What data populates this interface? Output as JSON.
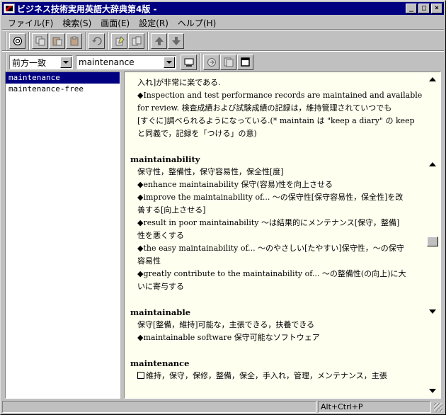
{
  "window": {
    "title": "ビジネス技術実用英語大辞典第4版 -"
  },
  "menu": [
    "ファイル(F)",
    "検索(S)",
    "画面(E)",
    "設定(R)",
    "ヘルプ(H)"
  ],
  "toolbar": {
    "icons": [
      "search-icon",
      "copy-icon",
      "paste-icon",
      "clipboard-icon",
      "undo-icon",
      "note-icon",
      "notes-icon",
      "up-arrow-icon",
      "down-arrow-icon"
    ]
  },
  "search": {
    "mode": "前方一致",
    "query": "maintenance"
  },
  "results": {
    "items": [
      "maintenance",
      "maintenance-free"
    ],
    "selected_index": 0
  },
  "content": {
    "lines_top": [
      "入れ]が非常に楽である.",
      "◆Inspection and test performance records are maintained and available",
      "for review.  検査成績および試験成績の記録は，維持管理されていつでも",
      "[すぐに]調べられるようになっている.(* maintain は \"keep a diary\" の keep",
      "と同義で，記録を「つける」の意)"
    ],
    "entries": [
      {
        "headword": "maintainability",
        "lines": [
          "保守性，整備性，保守容易性，保全性[度]",
          "◆enhance maintainability  保守(容易)性を向上させる",
          "◆improve the maintainability of...  ～の保守性[保守容易性，保全性]を改",
          "善する[向上させる]",
          "◆result in poor maintainability  ～は結果的にメンテナンス[保守，整備]",
          "性を悪くする",
          "◆the easy maintainability of...  ～のやさしい[たやすい]保守性，～の保守",
          "容易性",
          "◆greatly contribute to the maintainability of...  ～の整備性(の向上)に大",
          "いに寄与する"
        ]
      },
      {
        "headword": "maintainable",
        "lines": [
          "保守[整備，維持]可能な，主張できる，扶養できる",
          "◆maintainable software  保守可能なソフトウェア"
        ]
      },
      {
        "headword": "maintenance",
        "lines": [
          "維持，保守，保修，整備，保全，手入れ，管理，メンテナンス，主張"
        ]
      }
    ]
  },
  "status": {
    "left": "",
    "shortcut": "Alt+Ctrl+P"
  }
}
